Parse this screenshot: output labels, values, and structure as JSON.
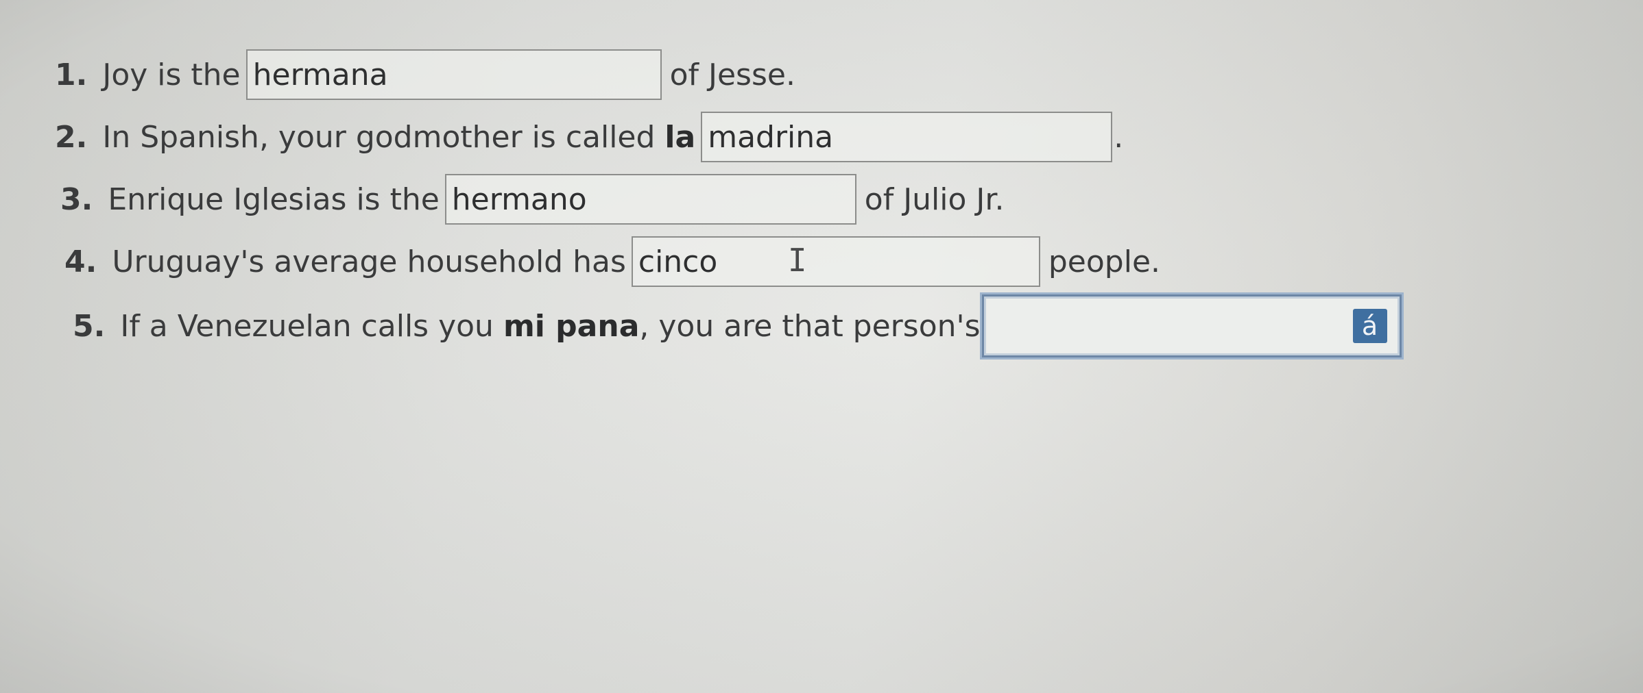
{
  "questions": [
    {
      "number": "1.",
      "before": "Joy is the",
      "answer": "hermana",
      "after": "of Jesse."
    },
    {
      "number": "2.",
      "before": "In Spanish, your godmother is called",
      "bold_word": "la",
      "answer": "madrina",
      "after": "."
    },
    {
      "number": "3.",
      "before": "Enrique Iglesias is the",
      "answer": "hermano",
      "after": "of Julio Jr."
    },
    {
      "number": "4.",
      "before": "Uruguay's average household has",
      "answer": "cinco",
      "after": "people."
    },
    {
      "number": "5.",
      "before": "If a Venezuelan calls you",
      "bold_word": "mi pana",
      "before_end": ", you are that person's",
      "answer": "",
      "after": ""
    }
  ],
  "accent_button": {
    "label": "á"
  },
  "cursor_glyph": "I",
  "colors": {
    "active_border": "#6d87a6",
    "accent_button_bg": "#3f6fa0"
  }
}
